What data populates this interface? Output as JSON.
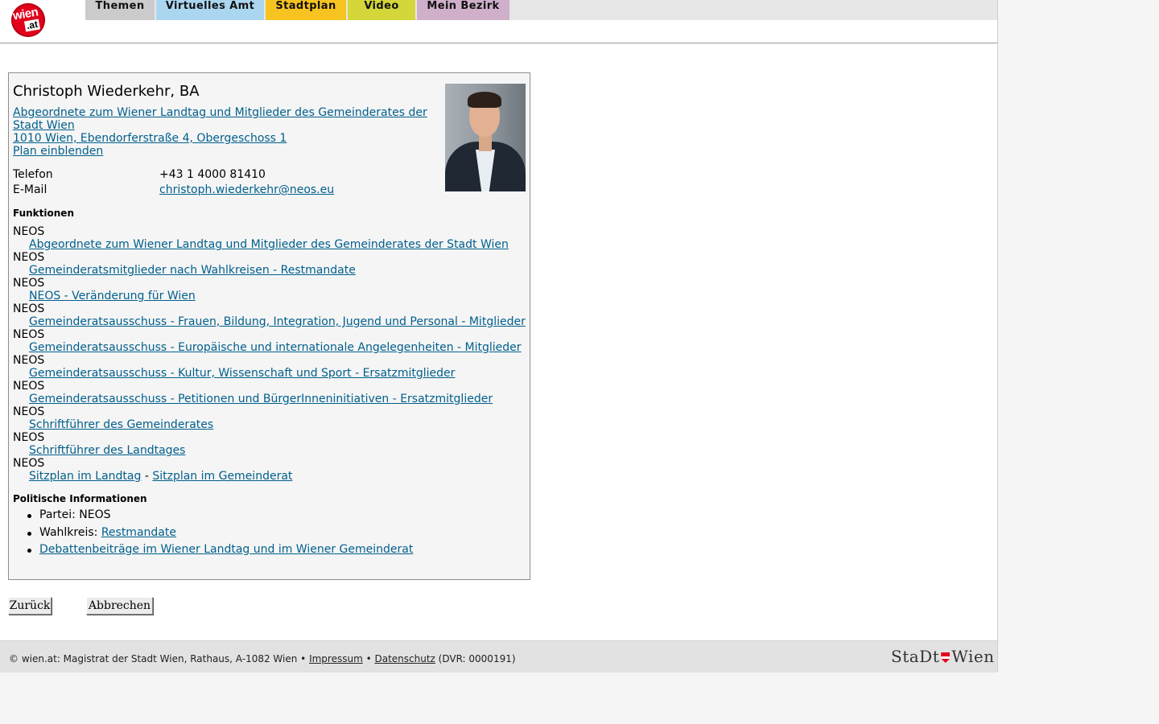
{
  "header": {
    "logo_text": "wien",
    "logo_sub": ".at",
    "tabs": [
      "Themen",
      "Virtuelles Amt",
      "Stadtplan",
      "Video",
      "Mein Bezirk"
    ]
  },
  "person": {
    "name": "Christoph Wiederkehr, BA",
    "org_line1": "Abgeordnete zum Wiener Landtag und Mitglieder des Gemeinderates der",
    "org_line2": "Stadt Wien ",
    "address": "1010 Wien, Ebendorferstraße 4, Obergeschoss 1",
    "plan_link": "Plan einblenden",
    "phone_label": "Telefon",
    "phone": "+43 1 4000 81410",
    "email_label": "E-Mail",
    "email": "christoph.wiederkehr@neos.eu"
  },
  "functions": {
    "heading": "Funktionen",
    "items": [
      {
        "org": "NEOS",
        "link": "Abgeordnete zum Wiener Landtag und Mitglieder des Gemeinderates der Stadt Wien"
      },
      {
        "org": "NEOS",
        "link": "Gemeinderatsmitglieder nach Wahlkreisen - Restmandate"
      },
      {
        "org": "NEOS",
        "link": "NEOS - Veränderung für Wien"
      },
      {
        "org": "NEOS",
        "link": "Gemeinderatsausschuss - Frauen, Bildung, Integration, Jugend und Personal - Mitglieder"
      },
      {
        "org": "NEOS",
        "link": "Gemeinderatsausschuss - Europäische und internationale Angelegenheiten - Mitglieder"
      },
      {
        "org": "NEOS",
        "link": "Gemeinderatsausschuss - Kultur, Wissenschaft und Sport - Ersatzmitglieder"
      },
      {
        "org": "NEOS",
        "link": "Gemeinderatsausschuss - Petitionen und BürgerInneninitiativen - Ersatzmitglieder"
      },
      {
        "org": "NEOS",
        "link": "Schriftführer des Gemeinderates"
      },
      {
        "org": "NEOS",
        "link": "Schriftführer des Landtages"
      }
    ],
    "last_org": "NEOS",
    "seat_landtag": "Sitzplan im Landtag",
    "seat_sep": " - ",
    "seat_gemeinderat": "Sitzplan im Gemeinderat"
  },
  "political": {
    "heading": "Politische Informationen",
    "party": "Partei: NEOS",
    "district_label": "Wahlkreis: ",
    "district_link": "Restmandate",
    "debates": "Debattenbeiträge im Wiener Landtag und im Wiener Gemeinderat"
  },
  "buttons": {
    "back": "Zurück",
    "cancel": "Abbrechen"
  },
  "footer": {
    "copyright": "© wien.at: Magistrat der Stadt Wien, Rathaus, A-1082 Wien • ",
    "impressum": "Impressum",
    "sep": " • ",
    "datenschutz": "Datenschutz",
    "dvr": " (DVR: 0000191)",
    "logo_left": "StaDt",
    "logo_right": "Wien"
  },
  "colors": {
    "link": "#005f8c",
    "tab_themen": "#cbcbcb",
    "tab_amt": "#abd6f0",
    "tab_stadtplan": "#f7c320",
    "tab_video": "#d4d63a",
    "tab_bezirk": "#cfafc9",
    "logo_red": "#e3001b"
  }
}
